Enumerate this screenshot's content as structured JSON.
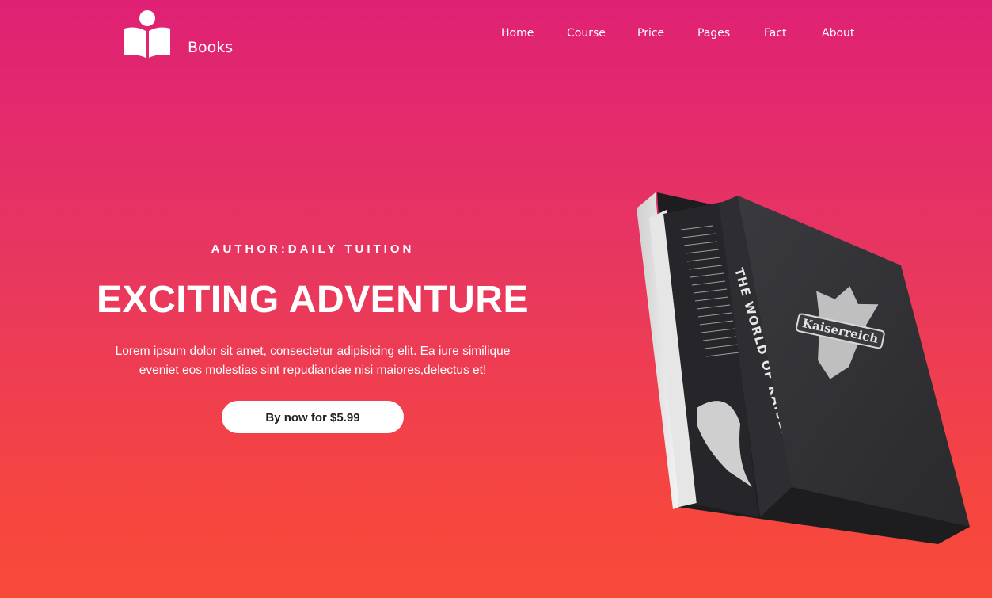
{
  "brand": {
    "name": "Books"
  },
  "nav": {
    "items": [
      "Home",
      "Course",
      "Price",
      "Pages",
      "Fact",
      "About"
    ]
  },
  "hero": {
    "author": "AUTHOR:DAILY TUITION",
    "title": "EXCITING ADVENTURE",
    "description_line1": "Lorem ipsum dolor sit amet, consectetur adipisicing elit. Ea iure similique",
    "description_line2": "eveniet eos molestias sint repudiandae nisi maiores,delectus et!",
    "cta_label": "By now for $5.99"
  },
  "book": {
    "spine_text": "THE WORLD OF KAISERREICH",
    "cover_text": "Kaiserreich"
  },
  "colors": {
    "gradient_top": "#df2175",
    "gradient_bottom": "#f84a3b",
    "book_cover": "#3a3a3e"
  }
}
